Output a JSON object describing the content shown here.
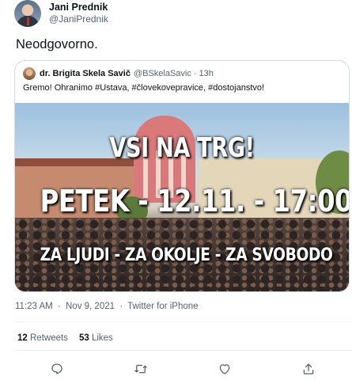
{
  "tweet": {
    "author": {
      "display_name": "Jani Prednik",
      "handle": "@JaniPrednik"
    },
    "text": "Neodgovorno.",
    "quoted": {
      "display_name": "dr. Brigita Skela Savič",
      "handle": "@BSkelaSavic",
      "separator": "·",
      "time": "13h",
      "text": "Gremo! Ohranimo #Ustava, #človekovepravice, #dostojanstvo!",
      "media": {
        "line1": "VSI NA TRG!",
        "line2": "PETEK - 12.11. - 17:00",
        "line3": "ZA LJUDI - ZA OKOLJE - ZA SVOBODO"
      }
    },
    "meta": {
      "time": "11:23 AM",
      "dot": "·",
      "date": "Nov 9, 2021",
      "source": "Twitter for iPhone"
    },
    "stats": {
      "retweets_count": "12",
      "retweets_label": "Retweets",
      "likes_count": "53",
      "likes_label": "Likes"
    },
    "actions": {
      "reply": "reply-icon",
      "retweet": "retweet-icon",
      "like": "heart-icon",
      "share": "share-icon"
    }
  },
  "colors": {
    "text": "#0f1419",
    "secondary": "#536471",
    "border": "#cfd9de"
  }
}
